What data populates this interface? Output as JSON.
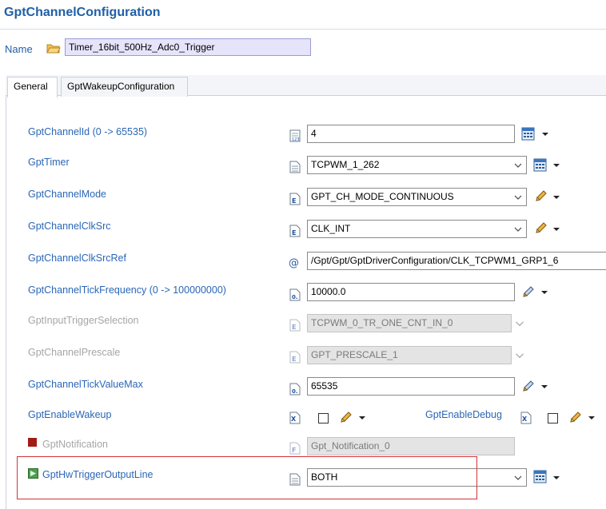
{
  "header": {
    "title": "GptChannelConfiguration"
  },
  "name_row": {
    "label": "Name",
    "value": "Timer_16bit_500Hz_Adc0_Trigger"
  },
  "tabs": [
    {
      "label": "General",
      "active": true
    },
    {
      "label": "GptWakeupConfiguration",
      "active": false
    }
  ],
  "rows": {
    "channel_id": {
      "label": "GptChannelId (0 -> 65535)",
      "value": "4"
    },
    "timer": {
      "label": "GptTimer",
      "value": "TCPWM_1_262"
    },
    "mode": {
      "label": "GptChannelMode",
      "value": "GPT_CH_MODE_CONTINUOUS"
    },
    "clk_src": {
      "label": "GptChannelClkSrc",
      "value": "CLK_INT"
    },
    "clk_src_ref": {
      "label": "GptChannelClkSrcRef",
      "value": "/Gpt/Gpt/GptDriverConfiguration/CLK_TCPWM1_GRP1_6"
    },
    "tick_freq": {
      "label": "GptChannelTickFrequency (0 -> 100000000)",
      "value": "10000.0"
    },
    "input_trigger": {
      "label": "GptInputTriggerSelection",
      "value": "TCPWM_0_TR_ONE_CNT_IN_0",
      "disabled": true
    },
    "prescale": {
      "label": "GptChannelPrescale",
      "value": "GPT_PRESCALE_1",
      "disabled": true
    },
    "tick_max": {
      "label": "GptChannelTickValueMax",
      "value": "65535"
    },
    "enable_wakeup": {
      "label": "GptEnableWakeup",
      "checked": false
    },
    "enable_debug": {
      "label": "GptEnableDebug",
      "checked": false
    },
    "notification": {
      "label": "GptNotification",
      "value": "Gpt_Notification_0",
      "disabled": true
    },
    "hw_trigger": {
      "label": "GptHwTriggerOutputLine",
      "value": "BOTH"
    }
  },
  "colors": {
    "label_blue": "#2a66b6",
    "title_blue": "#1f5fa8",
    "highlight_red": "#d1333c",
    "name_field_bg": "#e6e4fb"
  },
  "icons": [
    "folder-icon",
    "document-icon",
    "calculator-icon",
    "pencil-icon",
    "at-icon",
    "checkbox-icon",
    "chevron-down-icon"
  ]
}
